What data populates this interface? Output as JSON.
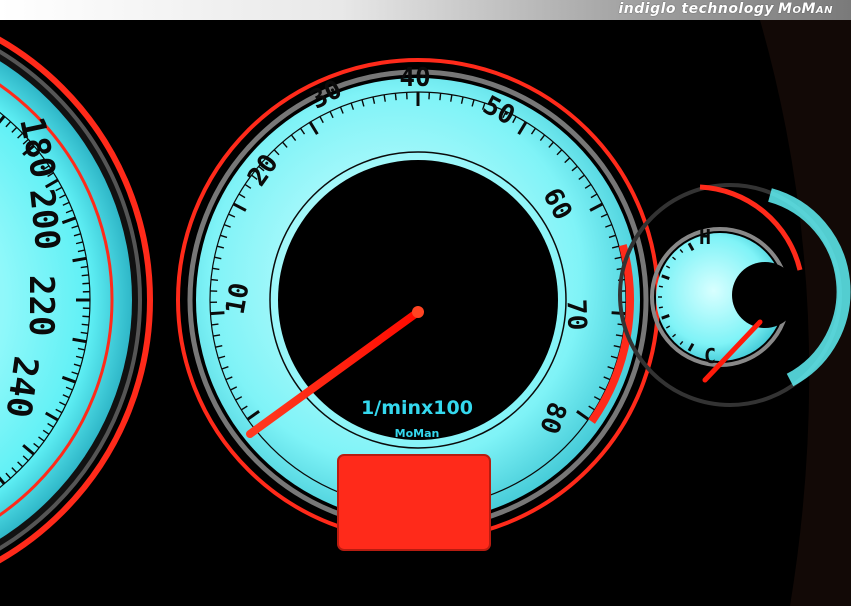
{
  "banner": {
    "text": "indiglo technology",
    "brand": "MoMan"
  },
  "speedometer": {
    "labels": [
      "180",
      "200",
      "220",
      "240"
    ]
  },
  "tachometer": {
    "labels": [
      "10",
      "20",
      "30",
      "40",
      "50",
      "60",
      "70",
      "80"
    ],
    "unit": "1/minx100",
    "logo": "MoMan"
  },
  "temp_gauge": {
    "hot_label": "H",
    "cold_label": "C"
  },
  "colors": {
    "dial_glow": "#5ff0f5",
    "redline": "#ff2a1a",
    "needle": "#ff1a0a",
    "text": "#0a0a0a",
    "background": "#000000"
  }
}
